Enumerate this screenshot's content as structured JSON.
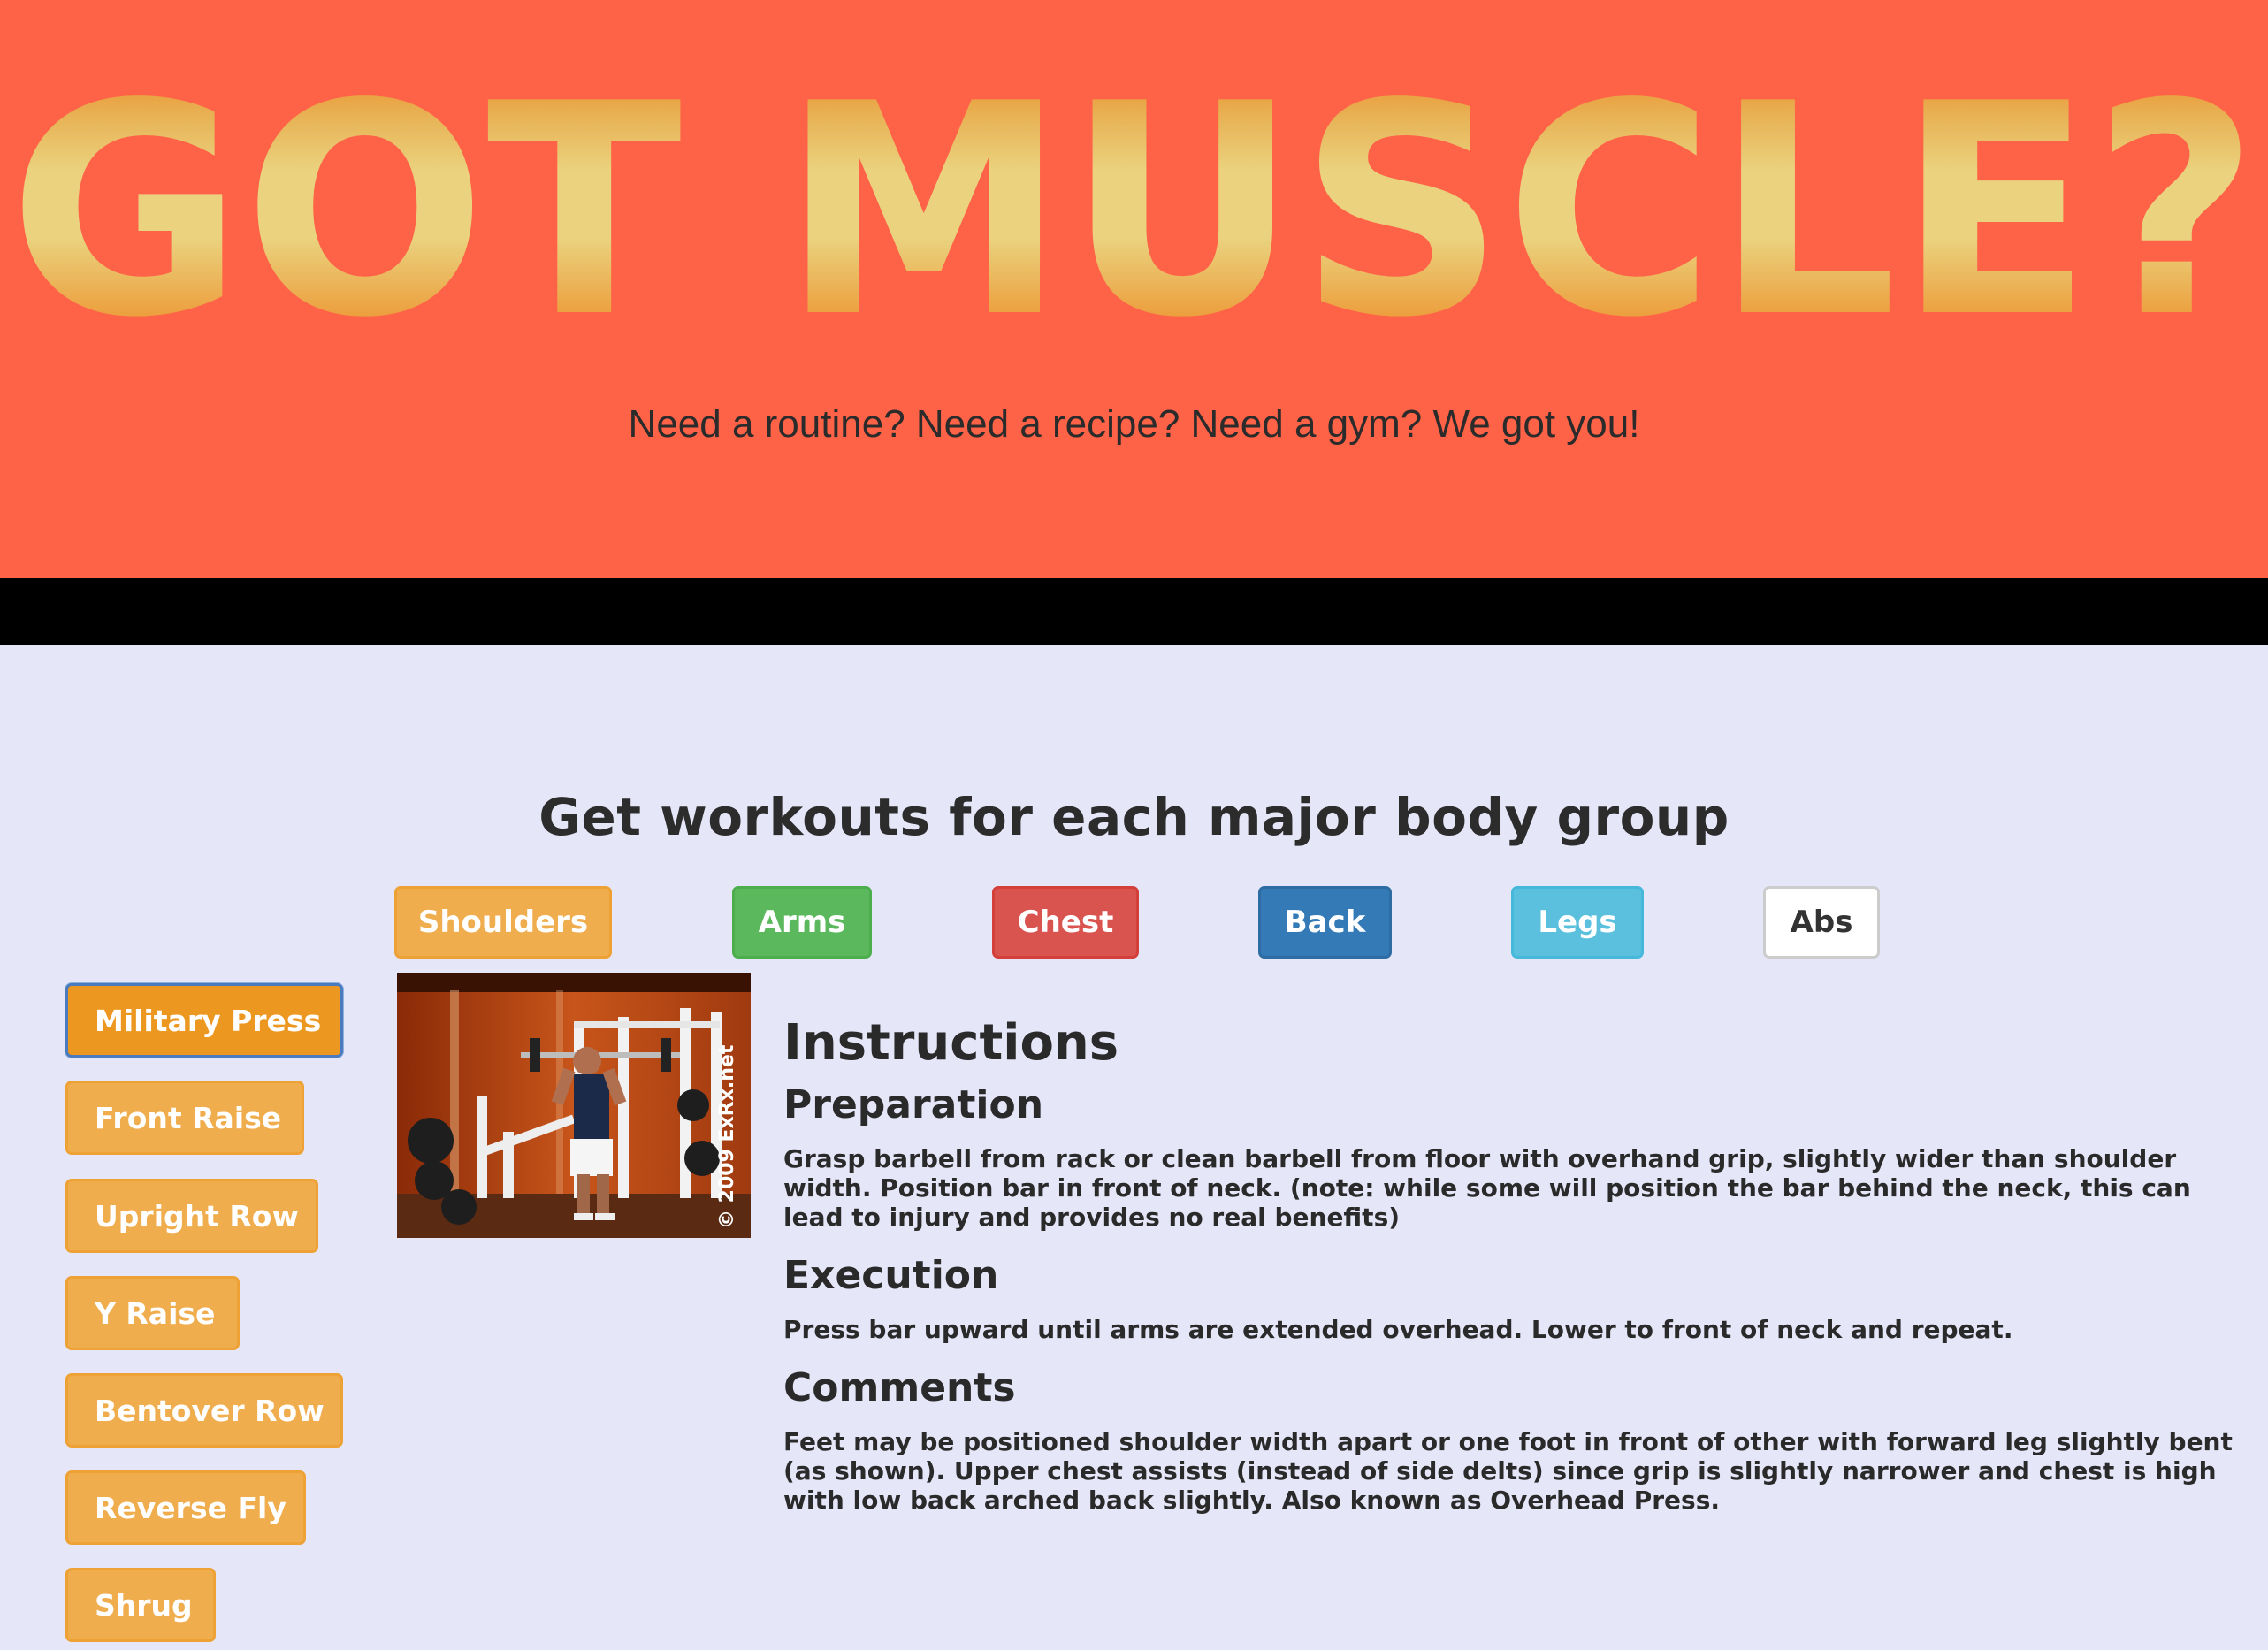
{
  "hero": {
    "title": "GOT MUSCLE?",
    "tagline": "Need a routine? Need a recipe? Need a gym? We got you!",
    "background": "#ff6347"
  },
  "workouts": {
    "heading": "Get workouts for each major body group",
    "tabs": [
      {
        "label": "Shoulders",
        "color": "#f0ad4e"
      },
      {
        "label": "Arms",
        "color": "#5cb85c"
      },
      {
        "label": "Chest",
        "color": "#d9534f"
      },
      {
        "label": "Back",
        "color": "#337ab7"
      },
      {
        "label": "Legs",
        "color": "#5bc0de"
      },
      {
        "label": "Abs",
        "color": "#ffffff"
      }
    ],
    "exercises": [
      {
        "label": "Military Press",
        "active": true
      },
      {
        "label": "Front Raise",
        "active": false
      },
      {
        "label": "Upright Row",
        "active": false
      },
      {
        "label": "Y Raise",
        "active": false
      },
      {
        "label": "Bentover Row",
        "active": false
      },
      {
        "label": "Reverse Fly",
        "active": false
      },
      {
        "label": "Shrug",
        "active": false
      }
    ]
  },
  "image": {
    "watermark": "© 2009 ExRx.net"
  },
  "instructions": {
    "title": "Instructions",
    "preparation_heading": "Preparation",
    "preparation_text": "Grasp barbell from rack or clean barbell from floor with overhand grip, slightly wider than shoulder width. Position bar in front of neck. (note: while some will position the bar behind the neck, this can lead to injury and provides no real benefits)",
    "execution_heading": "Execution",
    "execution_text": "Press bar upward until arms are extended overhead. Lower to front of neck and repeat.",
    "comments_heading": "Comments",
    "comments_text": "Feet may be positioned shoulder width apart or one foot in front of other with forward leg slightly bent (as shown). Upper chest assists (instead of side delts) since grip is slightly narrower and chest is high with low back arched back slightly. Also known as Overhead Press."
  }
}
